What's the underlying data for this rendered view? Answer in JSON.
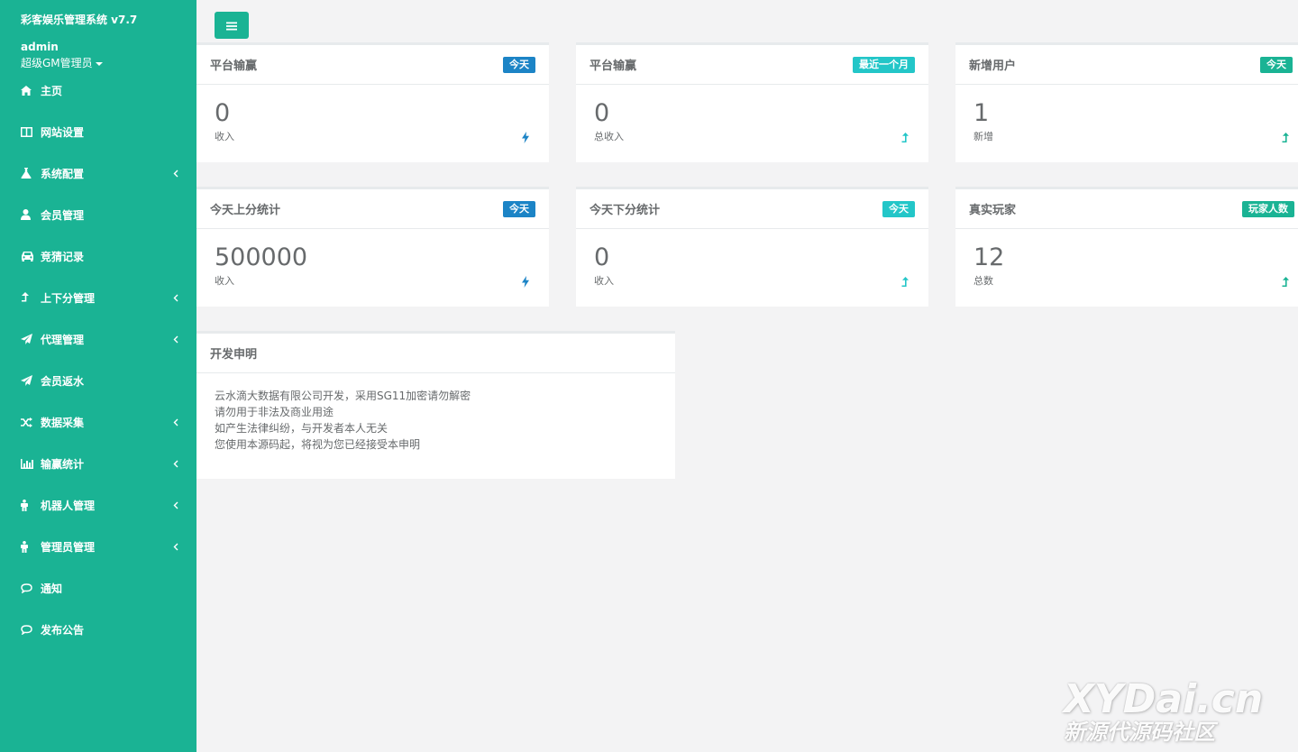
{
  "sidebar": {
    "app_title": "彩客娱乐管理系统 v7.7",
    "user_name": "admin",
    "user_role": "超级GM管理员",
    "items": [
      {
        "label": "主页",
        "icon": "home-icon",
        "has_arrow": false
      },
      {
        "label": "网站设置",
        "icon": "columns-icon",
        "has_arrow": false
      },
      {
        "label": "系统配置",
        "icon": "flask-icon",
        "has_arrow": true
      },
      {
        "label": "会员管理",
        "icon": "user-icon",
        "has_arrow": false
      },
      {
        "label": "竞猜记录",
        "icon": "car-icon",
        "has_arrow": false
      },
      {
        "label": "上下分管理",
        "icon": "level-up-icon",
        "has_arrow": true
      },
      {
        "label": "代理管理",
        "icon": "paper-plane-icon",
        "has_arrow": true
      },
      {
        "label": "会员返水",
        "icon": "paper-plane-icon",
        "has_arrow": false
      },
      {
        "label": "数据采集",
        "icon": "random-icon",
        "has_arrow": true
      },
      {
        "label": "输赢统计",
        "icon": "bar-chart-icon",
        "has_arrow": true
      },
      {
        "label": "机器人管理",
        "icon": "male-icon",
        "has_arrow": true
      },
      {
        "label": "管理员管理",
        "icon": "male-icon",
        "has_arrow": true
      },
      {
        "label": "通知",
        "icon": "comment-icon",
        "has_arrow": false
      },
      {
        "label": "发布公告",
        "icon": "comment-icon",
        "has_arrow": false
      }
    ]
  },
  "toolbar": {
    "menu_icon": "bars-icon"
  },
  "cards": [
    {
      "title": "平台输赢",
      "badge": "今天",
      "badge_color": "#1c84c6",
      "value": "0",
      "label": "收入",
      "icon": "bolt-icon",
      "icon_color": "#1c84c6"
    },
    {
      "title": "平台输赢",
      "badge": "最近一个月",
      "badge_color": "#23c6c8",
      "value": "0",
      "label": "总收入",
      "icon": "level-up-icon",
      "icon_color": "#23c6c8"
    },
    {
      "title": "新增用户",
      "badge": "今天",
      "badge_color": "#1ab394",
      "value": "1",
      "label": "新增",
      "icon": "level-up-icon",
      "icon_color": "#1ab394"
    },
    {
      "title": "今天上分统计",
      "badge": "今天",
      "badge_color": "#1c84c6",
      "value": "500000",
      "label": "收入",
      "icon": "bolt-icon",
      "icon_color": "#1c84c6"
    },
    {
      "title": "今天下分统计",
      "badge": "今天",
      "badge_color": "#23c6c8",
      "value": "0",
      "label": "收入",
      "icon": "level-up-icon",
      "icon_color": "#23c6c8"
    },
    {
      "title": "真实玩家",
      "badge": "玩家人数",
      "badge_color": "#1ab394",
      "value": "12",
      "label": "总数",
      "icon": "level-up-icon",
      "icon_color": "#1ab394"
    }
  ],
  "notice": {
    "title": "开发申明",
    "lines": [
      "云水滴大数据有限公司开发，采用SG11加密请勿解密",
      "请勿用于非法及商业用途",
      "如产生法律纠纷，与开发者本人无关",
      "您使用本源码起，将视为您已经接受本申明"
    ]
  },
  "watermark": {
    "brand": "XYDai.cn",
    "sub": "新源代源码社区"
  }
}
